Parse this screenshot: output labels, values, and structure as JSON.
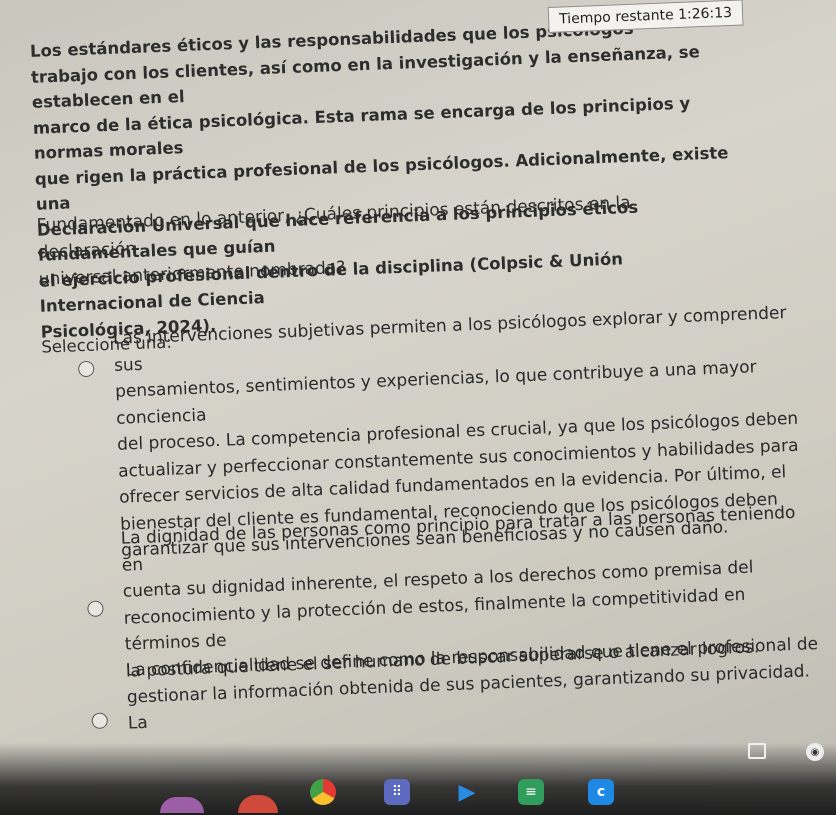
{
  "question": {
    "context_lines": [
      "Los estándares éticos y las responsabilidades que los psicólogos",
      "trabajo con los clientes, así como en la investigación y la enseñanza, se establecen en el",
      "marco de la ética psicológica. Esta rama se encarga de los principios y normas morales",
      "que rigen la práctica profesional de los psicólogos. Adicionalmente, existe una",
      "Declaración Universal que hace referencia a los principios éticos fundamentales que guían",
      "el ejercicio profesional dentro de la disciplina (Colpsic & Unión Internacional de Ciencia",
      "Psicológica, 2024)."
    ],
    "ask_lines": [
      "Fundamentado en lo anterior, ¿Cuáles principios están descritos en la declaración",
      "universal anteriormente nombrada?"
    ],
    "prompt": "Seleccione una:"
  },
  "timer": {
    "label": "Tiempo restante 1:26:13"
  },
  "options": [
    {
      "lines": [
        "Las intervenciones subjetivas permiten a los psicólogos explorar y comprender sus",
        "pensamientos, sentimientos y experiencias, lo que contribuye a una mayor conciencia",
        "del proceso. La competencia profesional es crucial, ya que los psicólogos deben",
        "actualizar y perfeccionar constantemente sus conocimientos y habilidades para",
        "ofrecer servicios de alta calidad fundamentados en la evidencia. Por último, el",
        "bienestar del cliente es fundamental, reconociendo que los psicólogos deben",
        "garantizar que sus intervenciones sean beneficiosas y no causen daño."
      ]
    },
    {
      "lines": [
        "La dignidad de las personas como principio para tratar a las personas teniendo en",
        "cuenta su dignidad inherente, el respeto a los derechos como premisa del",
        "reconocimiento y la protección de estos, finalmente la competitividad en términos de",
        "la postura que tiene el ser humano de buscar superarse o alcanzar logros."
      ]
    },
    {
      "lines": [
        "La confidencialidad se define como la responsabilidad que tiene el profesional de",
        "gestionar la información obtenida de sus pacientes, garantizando su privacidad. La"
      ]
    }
  ],
  "shelf_icons": [
    "gmail-icon",
    "youtube-icon",
    "chrome-icon",
    "apps-icon",
    "play-store-icon",
    "docs-icon",
    "classroom-icon"
  ],
  "colors": {
    "page_bg": "#d7d4cb",
    "text": "#2a2a2a",
    "timer_bg": "#f3f2ee"
  }
}
